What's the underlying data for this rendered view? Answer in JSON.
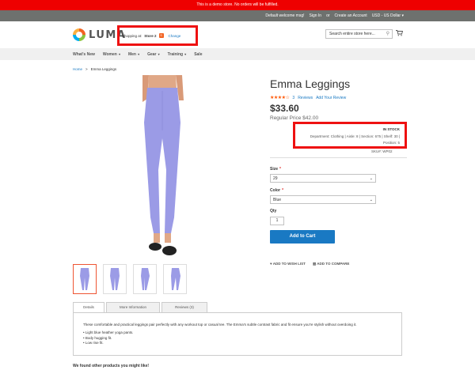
{
  "banner": {
    "text": "This is a demo store. No orders will be fulfilled."
  },
  "panel": {
    "welcome": "Default welcome msg!",
    "sign_in": "Sign In",
    "or": "or",
    "create_account": "Create an Account",
    "currency": "USD - US Dollar"
  },
  "logo": {
    "text": "LUMA"
  },
  "store_switcher": {
    "prefix": "Shopping at:",
    "store": "Store 2",
    "badge": "S",
    "change": "Change"
  },
  "search": {
    "placeholder": "Search entire store here..."
  },
  "nav": {
    "items": [
      {
        "label": "What's New"
      },
      {
        "label": "Women"
      },
      {
        "label": "Men"
      },
      {
        "label": "Gear"
      },
      {
        "label": "Training"
      },
      {
        "label": "Sale"
      }
    ]
  },
  "breadcrumb": {
    "home": "Home",
    "sep": ">",
    "current": "Emma Leggings"
  },
  "product": {
    "title": "Emma Leggings",
    "rating_percent": 90,
    "reviews_count": "3",
    "reviews_label": "Reviews",
    "add_review": "Add Your Review",
    "price": "$33.60",
    "regular_price": "Regular Price $42.00",
    "stock": "IN STOCK",
    "department": "Department: Clothing | Aisle: 8 | Section: 675 | Shelf: 30 |",
    "position": "Position: 5",
    "sku": "SKU#:  WP02"
  },
  "options": {
    "size_label": "Size",
    "size_value": "29",
    "color_label": "Color",
    "color_value": "Blue",
    "qty_label": "Qty",
    "qty_value": "1",
    "required_mark": "*"
  },
  "actions": {
    "add_to_cart": "Add to Cart",
    "wishlist": "ADD TO WISH LIST",
    "compare": "ADD TO COMPARE"
  },
  "tabs": {
    "items": [
      {
        "label": "Details"
      },
      {
        "label": "More Information"
      },
      {
        "label": "Reviews (3)"
      }
    ],
    "description": "These comfortable and practical leggings pair perfectly with any workout top or casual tee. The Emma's subtle contrast fabric and fit ensure you're stylish without overdoing it.",
    "bullets": [
      "• Light blue heather yoga pants.",
      "• Body hugging fit.",
      "• Low rise fit."
    ]
  },
  "related": {
    "heading": "We found other products you might like!"
  },
  "colors": {
    "accent": "#1979c3",
    "banner": "#ee0000",
    "highlight": "#ee1111",
    "legging": "#9b9be6"
  }
}
